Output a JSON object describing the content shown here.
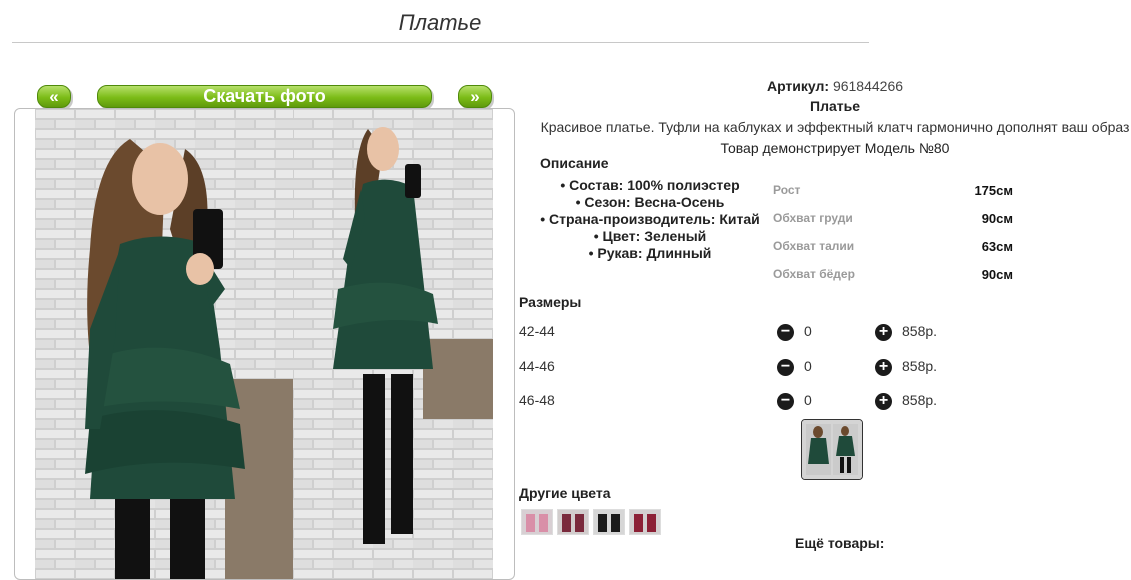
{
  "page": {
    "title": "Платье"
  },
  "gallery": {
    "prev_label": "«",
    "next_label": "»",
    "download_label": "Скачать фото"
  },
  "product": {
    "article_label": "Артикул:",
    "article_value": "961844266",
    "name": "Платье",
    "description": "Красивое платье. Туфли на каблуках и эффектный клатч гармонично дополнят ваш образ",
    "model_note": "Товар демонстрирует Модель №80"
  },
  "details": {
    "heading": "Описание",
    "items": [
      "Состав: 100% полиэстер",
      "Сезон: Весна-Осень",
      "Страна-производитель: Китай",
      "Цвет: Зеленый",
      "Рукав: Длинный"
    ]
  },
  "measurements": [
    {
      "label": "Рост",
      "value": "175см"
    },
    {
      "label": "Обхват груди",
      "value": "90см"
    },
    {
      "label": "Обхват талии",
      "value": "63см"
    },
    {
      "label": "Обхват бёдер",
      "value": "90см"
    }
  ],
  "sizes": {
    "heading": "Размеры",
    "rows": [
      {
        "size": "42-44",
        "qty": "0",
        "price": "858р."
      },
      {
        "size": "44-46",
        "qty": "0",
        "price": "858р."
      },
      {
        "size": "46-48",
        "qty": "0",
        "price": "858р."
      }
    ],
    "minus_icon": "minus-circle-icon",
    "plus_icon": "plus-circle-icon"
  },
  "other_colors": {
    "heading": "Другие цвета"
  },
  "more_products": {
    "heading": "Ещё товары:"
  },
  "colors": {
    "accent_green": "#7cbc17",
    "dress_green": "#1f4a3a"
  }
}
